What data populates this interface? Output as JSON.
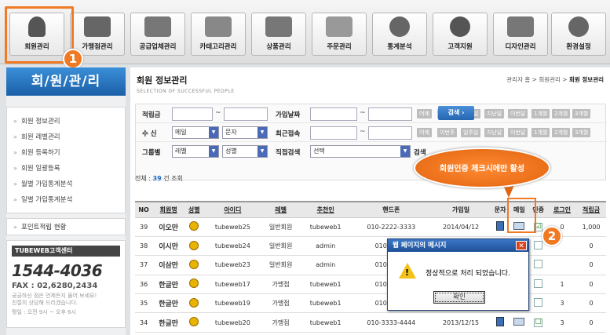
{
  "nav": {
    "tabs": [
      {
        "label": "회원관리",
        "icon": "person-icon"
      },
      {
        "label": "가맹점관리",
        "icon": "store-icon"
      },
      {
        "label": "공급업체관리",
        "icon": "supplier-icon"
      },
      {
        "label": "카테고리관리",
        "icon": "category-icon"
      },
      {
        "label": "상품관리",
        "icon": "product-icon"
      },
      {
        "label": "주문관리",
        "icon": "order-icon"
      },
      {
        "label": "통계분석",
        "icon": "stats-icon"
      },
      {
        "label": "고객지원",
        "icon": "support-icon"
      },
      {
        "label": "디자인관리",
        "icon": "design-icon"
      },
      {
        "label": "환경설정",
        "icon": "settings-icon"
      }
    ]
  },
  "annotations": {
    "badge1": "1",
    "badge2": "2",
    "callout": "회원인증 체크시에만 활성"
  },
  "sidebar": {
    "title": "회/원/관/리",
    "items": [
      "회원 정보관리",
      "회원 레벨관리",
      "회원 등록하기",
      "회원 일괄등록",
      "월별 가입통계분석",
      "일별 가입통계분석"
    ],
    "extra": "포인트적립 현황",
    "cs_title": "TUBEWEB고객센터",
    "cs_phone": "1544-4036",
    "cs_fax": "FAX : 02,6280,2434",
    "cs_note1": "궁금하신 점은 언제든지 물어 보세요!",
    "cs_note2": "친절히 상담해 드리겠습니다.",
    "cs_note3": "평일 : 오전 9시 ~ 오후 6시"
  },
  "header": {
    "title": "회원 정보관리",
    "subtitle": "SELECTION OF SUCCESSFUL PEOPLE",
    "breadcrumb_prefix": "관리자 홈 > 회원관리 > ",
    "breadcrumb_current": "회원 정보관리"
  },
  "search": {
    "points_label": "적립금",
    "join_date_label": "가입날짜",
    "receive_label": "수 신",
    "receive_opt1": "메일",
    "receive_opt2": "문자",
    "last_login_label": "최근접속",
    "group_label": "그룹별",
    "group_opt1": "레벨",
    "group_opt2": "성별",
    "direct_label": "직접검색",
    "direct_opt": "선택",
    "search_label": "검색",
    "tilde": "~",
    "date_buttons": [
      "어제",
      "이번주",
      "일주일",
      "지난달",
      "이번달",
      "1개월",
      "2개월",
      "3개월"
    ],
    "search_button": "검색"
  },
  "total": {
    "prefix": "전체 : ",
    "count": "39",
    "suffix": "건 조회"
  },
  "table": {
    "headers": [
      "NO",
      "회원명",
      "성별",
      "아이디",
      "레벨",
      "추천인",
      "핸드폰",
      "가입일",
      "문자",
      "메일",
      "인증",
      "로그인",
      "적립금"
    ],
    "rows": [
      {
        "no": "39",
        "name": "이오만",
        "id": "tubeweb25",
        "level": "일반회원",
        "ref": "tubeweb1",
        "phone": "010-2222-3333",
        "date": "2014/04/12",
        "auth": "☑",
        "login": "0",
        "points": "1,000"
      },
      {
        "no": "38",
        "name": "이시만",
        "id": "tubeweb24",
        "level": "일반회원",
        "ref": "admin",
        "phone": "010-2323-",
        "date": "",
        "auth": "",
        "login": "",
        "points": "0"
      },
      {
        "no": "37",
        "name": "이삼만",
        "id": "tubeweb23",
        "level": "일반회원",
        "ref": "admin",
        "phone": "010-3434-",
        "date": "",
        "auth": "",
        "login": "",
        "points": "0"
      },
      {
        "no": "36",
        "name": "한글만",
        "id": "tubeweb17",
        "level": "가맹점",
        "ref": "tubeweb1",
        "phone": "010-3333-",
        "date": "",
        "auth": "",
        "login": "1",
        "points": "0"
      },
      {
        "no": "35",
        "name": "한글만",
        "id": "tubeweb19",
        "level": "가맹점",
        "ref": "tubeweb1",
        "phone": "010-3333-",
        "date": "",
        "auth": "",
        "login": "3",
        "points": "0"
      },
      {
        "no": "34",
        "name": "한글만",
        "id": "tubeweb20",
        "level": "가맹점",
        "ref": "tubeweb1",
        "phone": "010-3333-4444",
        "date": "2013/12/15",
        "auth": "☐",
        "login": "3",
        "points": "0"
      }
    ]
  },
  "dialog": {
    "title": "웹 페이지의 메시지",
    "close": "✕",
    "icon_glyph": "!",
    "message": "정상적으로 처리 되었습니다.",
    "ok": "확인"
  }
}
